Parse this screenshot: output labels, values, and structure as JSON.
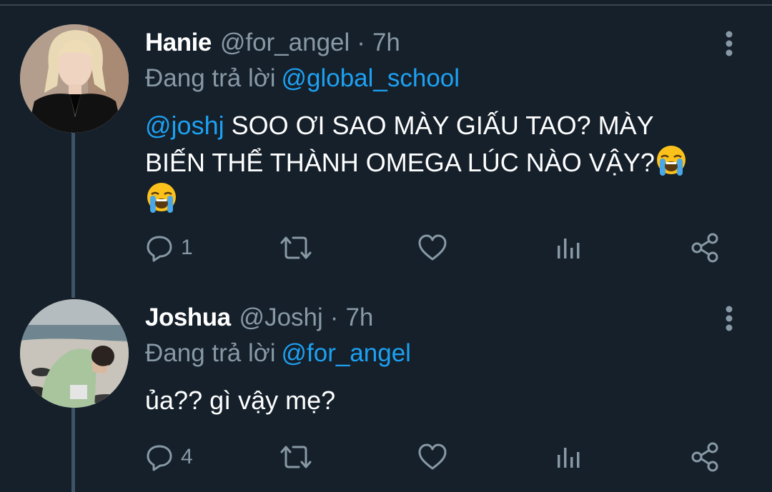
{
  "tweets": [
    {
      "name": "Hanie",
      "handle": "@for_angel",
      "dot": "·",
      "time": "7h",
      "replying_prefix": "Đang trả lời",
      "replying_to": "@global_school",
      "mention": "@joshj",
      "text_line1": " SOO ƠI SAO MÀY GIẤU TAO? MÀY",
      "text_line2": "BIẾN THỂ THÀNH OMEGA LÚC NÀO VẬY?",
      "emojis": [
        "loudly-crying-face",
        "loudly-crying-face"
      ],
      "reply_count": "1",
      "avatar": "person-with-blonde-hair-black-blazer"
    },
    {
      "name": "Joshua",
      "handle": "@Joshj",
      "dot": "·",
      "time": "7h",
      "replying_prefix": "Đang trả lời",
      "replying_to": "@for_angel",
      "text": "ủa?? gì vậy mẹ?",
      "reply_count": "4",
      "avatar": "person-crouching-on-beach"
    }
  ],
  "icons": {
    "reply": "reply-bubble-icon",
    "retweet": "retweet-icon",
    "like": "heart-icon",
    "stats": "analytics-icon",
    "share": "share-icon",
    "more": "vertical-dots-icon"
  },
  "colors": {
    "background": "#15202b",
    "text": "#ffffff",
    "secondary": "#8899a6",
    "link": "#1da1f2",
    "thread_line": "#3d5466"
  }
}
